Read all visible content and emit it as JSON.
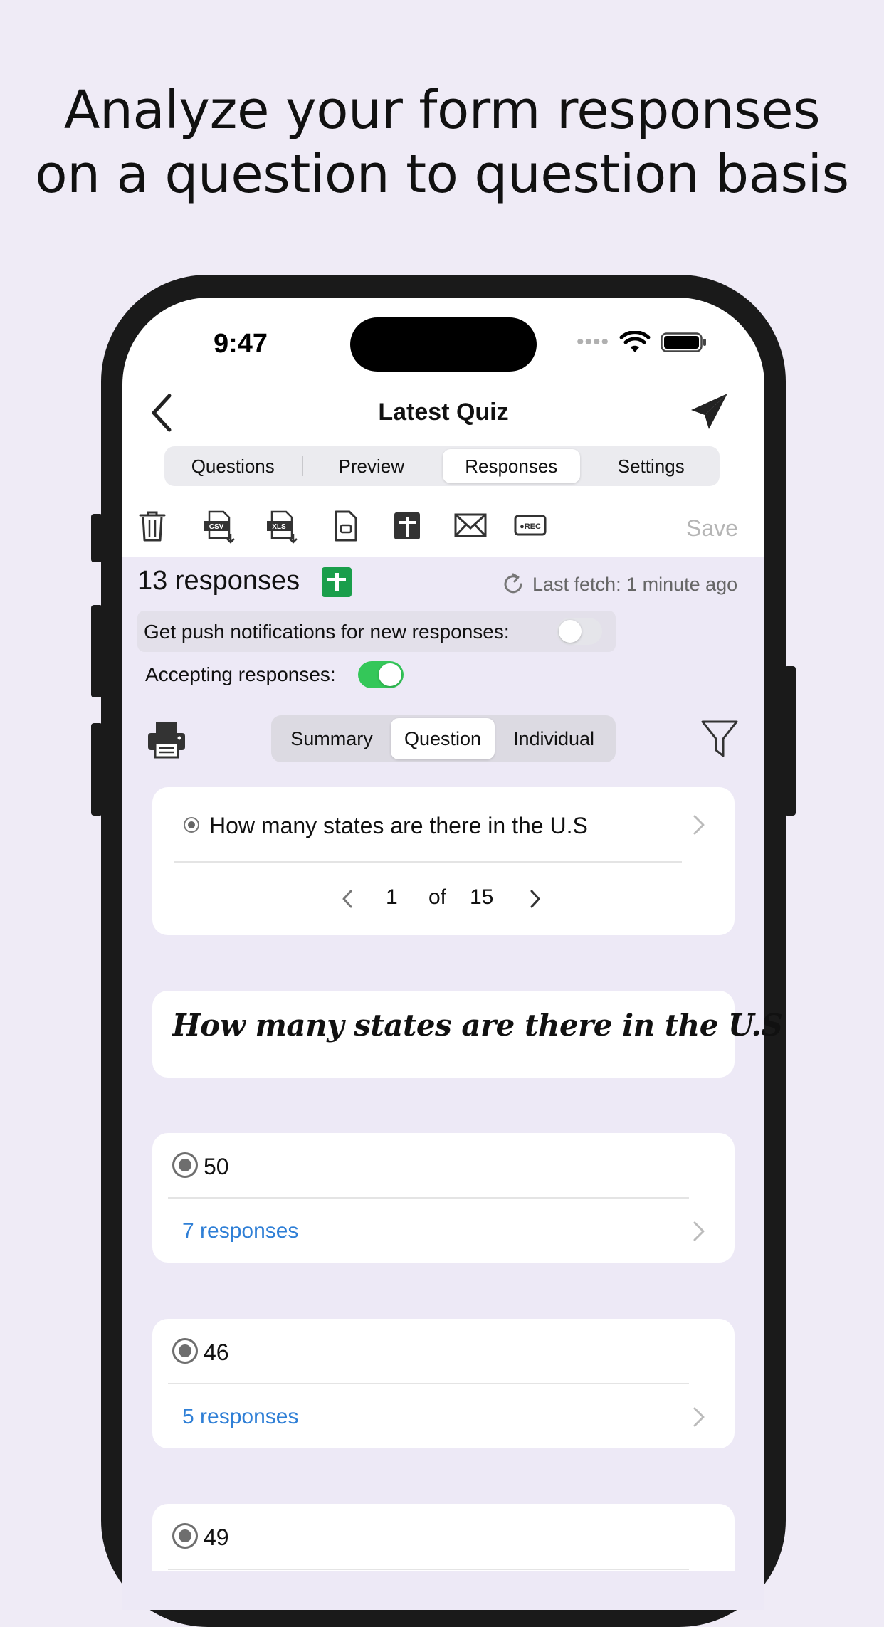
{
  "headline": {
    "line1": "Analyze your form responses",
    "line2": "on a question to question basis"
  },
  "status_bar": {
    "time": "9:47",
    "signal_dots": "••••"
  },
  "nav": {
    "title": "Latest Quiz"
  },
  "top_tabs": [
    {
      "label": "Questions",
      "active": false
    },
    {
      "label": "Preview",
      "active": false
    },
    {
      "label": "Responses",
      "active": true
    },
    {
      "label": "Settings",
      "active": false
    }
  ],
  "toolbar": {
    "icons": [
      "trash-icon",
      "csv-export-icon",
      "xls-export-icon",
      "document-icon",
      "sheets-icon",
      "mail-icon",
      "record-icon"
    ],
    "csv_text": "CSV",
    "xls_text": "XLS",
    "rec_text": "●REC",
    "save_label": "Save"
  },
  "summary": {
    "count_label": "13 responses",
    "last_fetch": "Last fetch: 1 minute ago",
    "push_label": "Get push notifications for new responses:",
    "push_enabled": false,
    "accepting_label": "Accepting responses:",
    "accepting_enabled": true
  },
  "view_tabs": [
    {
      "label": "Summary",
      "active": false
    },
    {
      "label": "Question",
      "active": true
    },
    {
      "label": "Individual",
      "active": false
    }
  ],
  "question_picker": {
    "question": "How many states are there in the U.S",
    "current": "1",
    "of_label": "of",
    "total": "15"
  },
  "question_heading": "How many states are there in the U.S",
  "options": [
    {
      "value": "50",
      "responses": "7 responses"
    },
    {
      "value": "46",
      "responses": "5 responses"
    },
    {
      "value": "49",
      "responses": ""
    }
  ],
  "colors": {
    "background": "#efebf6",
    "accent_green": "#34c759",
    "link_blue": "#2f7fd6",
    "sheets_green": "#1a9e4b"
  }
}
